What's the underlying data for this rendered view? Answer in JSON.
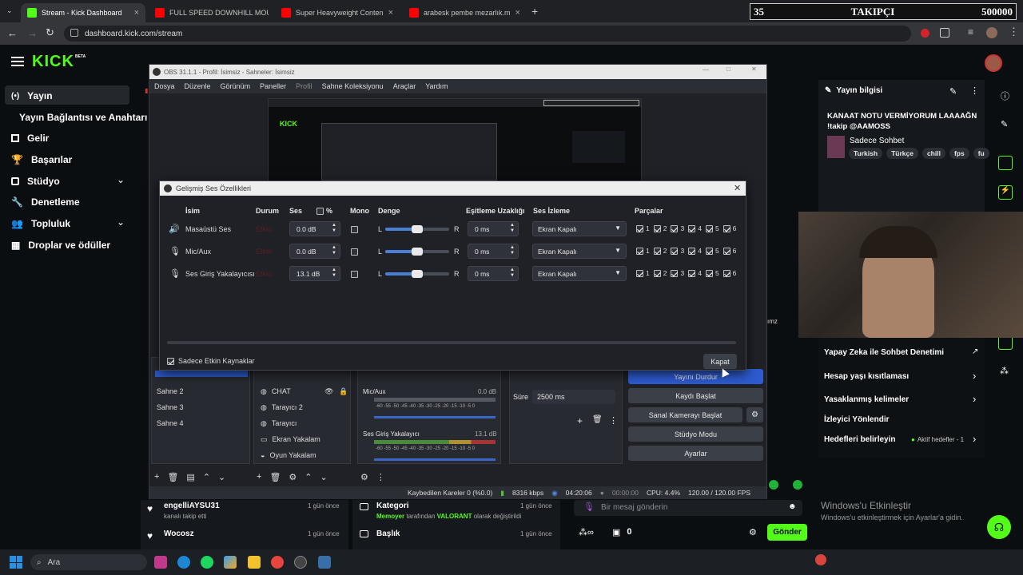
{
  "browser": {
    "tabs": [
      {
        "label": "Stream - Kick Dashboard",
        "color": "#53fc18"
      },
      {
        "label": "FULL SPEED DOWNHILL MOUN",
        "color": "#ff0000"
      },
      {
        "label": "Super Heavyweight Conten",
        "color": "#ff0000"
      },
      {
        "label": "arabesk pembe mezarlık.m",
        "color": "#ff0000"
      }
    ],
    "url": "dashboard.kick.com/stream",
    "follow_overlay": {
      "count": "35",
      "label": "TAKIPÇI",
      "goal": "500000"
    }
  },
  "kick": {
    "logo": "KICK",
    "logo_badge": "BETA",
    "sidebar": [
      {
        "label": "Yayın",
        "icon": "broadcast-icon"
      },
      {
        "label": "Yayın Bağlantısı ve Anahtarı",
        "icon": ""
      },
      {
        "label": "Gelir",
        "icon": "chart-icon"
      },
      {
        "label": "Başarılar",
        "icon": "trophy-icon"
      },
      {
        "label": "Stüdyo",
        "icon": "studio-icon"
      },
      {
        "label": "Denetleme",
        "icon": "wrench-icon"
      },
      {
        "label": "Topluluk",
        "icon": "community-icon"
      },
      {
        "label": "Droplar ve ödüller",
        "icon": "gift-icon"
      }
    ],
    "stream_info": {
      "header": "Yayın bilgisi",
      "title": "KANAAT NOTU VERMİYORUM LAAAAĞN !takip @AAMOSS",
      "category": "Sadece Sohbet",
      "tags": [
        "Turkish",
        "Türkçe",
        "chill",
        "fps",
        "fu"
      ]
    },
    "moderation": {
      "ai": "Yapay Zeka ile Sohbet Denetimi",
      "age": "Hesap yaşı kısıtlaması",
      "banned_words": "Yasaklanmış kelimeler",
      "viewer_directs": "İzleyici Yönlendir",
      "goals": "Hedefleri belirleyin",
      "goals_status": "Aktif hedefler - 1",
      "stub": "ımz"
    },
    "activity": [
      {
        "name": "engelliAYSU31",
        "desc": "kanalı takip etti",
        "time": "1 gün önce"
      },
      {
        "name": "Wocosz",
        "desc": "",
        "time": "1 gün önce"
      }
    ],
    "updates": [
      {
        "label": "Kategori",
        "desc_user": "Memoyer",
        "desc_mid": "tarafından",
        "desc_val": "VALORANT",
        "desc_end": "olarak değiştirildi",
        "time": "1 gün önce"
      },
      {
        "label": "Başlık",
        "time": "1 gün önce"
      }
    ],
    "chat": {
      "placeholder": "Bir mesaj gönderin",
      "count": "0",
      "send": "Gönder"
    },
    "windows_watermark": {
      "title": "Windows'u Etkinleştir",
      "sub": "Windows'u etkinleştirmek için Ayarlar'a gidin."
    }
  },
  "obs": {
    "title": "OBS 31.1.1 - Profil: İsimsiz - Sahneler: İsimsiz",
    "menu": [
      "Dosya",
      "Düzenle",
      "Görünüm",
      "Paneller",
      "Profil",
      "Sahne Koleksiyonu",
      "Araçlar",
      "Yardım"
    ],
    "scenes": [
      "Sahne 2",
      "Sahne 3",
      "Sahne 4"
    ],
    "sources": [
      "CHAT",
      "Tarayıcı 2",
      "Tarayıcı",
      "Ekran Yakalam",
      "Oyun Yakalam"
    ],
    "mixer": [
      {
        "name": "Mic/Aux",
        "level": "0.0 dB"
      },
      {
        "name": "Ses Giriş Yakalayıcı",
        "level": "13.1 dB"
      }
    ],
    "meter_ticks": [
      "-60",
      "-55",
      "-50",
      "-45",
      "-40",
      "-35",
      "-30",
      "-25",
      "-20",
      "-15",
      "-10",
      "-5",
      "0"
    ],
    "transition": {
      "label": "Süre",
      "value": "2500 ms"
    },
    "controls": [
      "Yayını Durdur",
      "Kaydı Başlat",
      "Sanal Kamerayı Başlat",
      "Stüdyo Modu",
      "Ayarlar"
    ],
    "status": {
      "dropped": "Kaybedilen Kareler 0 (%0.0)",
      "bitrate": "8316 kbps",
      "stream_time": "04:20:06",
      "rec_time": "00:00:00",
      "cpu": "CPU: 4.4%",
      "fps": "120.00 / 120.00 FPS"
    }
  },
  "dialog": {
    "title": "Gelişmiş Ses Özellikleri",
    "headers": {
      "name": "İsim",
      "status": "Durum",
      "volume": "Ses",
      "percent": "%",
      "mono": "Mono",
      "balance": "Denge",
      "sync": "Eşitleme Uzaklığı",
      "monitor": "Ses İzleme",
      "tracks": "Parçalar"
    },
    "rows": [
      {
        "name": "Masaüstü Ses",
        "status": "Etkin",
        "volume": "0.0 dB",
        "sync": "0 ms",
        "monitor": "Ekran Kapalı",
        "icon": "speaker-icon"
      },
      {
        "name": "Mic/Aux",
        "status": "Etkin",
        "volume": "0.0 dB",
        "sync": "0 ms",
        "monitor": "Ekran Kapalı",
        "icon": "mic-icon"
      },
      {
        "name": "Ses Giriş Yakalayıcısı",
        "status": "Etkin",
        "volume": "13.1 dB",
        "sync": "0 ms",
        "monitor": "Ekran Kapalı",
        "icon": "mic-icon"
      }
    ],
    "balance_left": "L",
    "balance_right": "R",
    "balance_position": 0.5,
    "track_numbers": [
      "1",
      "2",
      "3",
      "4",
      "5",
      "6"
    ],
    "active_only": "Sadece Etkin Kaynaklar",
    "close": "Kapat"
  },
  "taskbar": {
    "search": "Ara"
  }
}
